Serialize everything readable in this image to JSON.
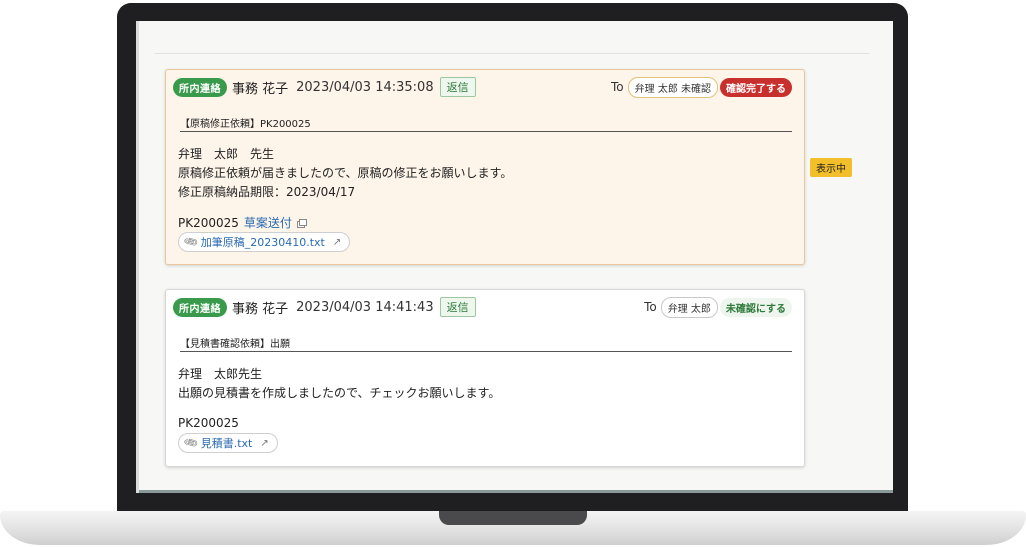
{
  "messages": [
    {
      "tag": "所内連絡",
      "sender": "事務 花子",
      "date": "2023/04/03 14:35:08",
      "reply_label": "返信",
      "to_label": "To",
      "recipient": "弁理 太郎 未確認",
      "action_label": "確認完了する",
      "subject": "【原稿修正依頼】PK200025",
      "body_lines": [
        "弁理　太郎　先生",
        "原稿修正依頼が届きましたので、原稿の修正をお願いします。",
        "修正原稿納品期限：2023/04/17"
      ],
      "ref_code": "PK200025",
      "ref_link": "草案送付",
      "attachment": "加筆原稿_20230410.txt"
    },
    {
      "tag": "所内連絡",
      "sender": "事務 花子",
      "date": "2023/04/03 14:41:43",
      "reply_label": "返信",
      "to_label": "To",
      "recipient": "弁理 太郎",
      "action_label": "未確認にする",
      "subject": "【見積書確認依頼】出願",
      "body_lines": [
        "弁理　太郎先生",
        "出願の見積書を作成しましたので、チェックお願いします。"
      ],
      "ref_code": "PK200025",
      "attachment": "見積書.txt"
    }
  ],
  "status_badge": "表示中",
  "colors": {
    "tag_green": "#3a9a4b",
    "action_red": "#c8302d",
    "active_bg": "#fdf4ea",
    "badge_yellow": "#f2bf2a"
  }
}
